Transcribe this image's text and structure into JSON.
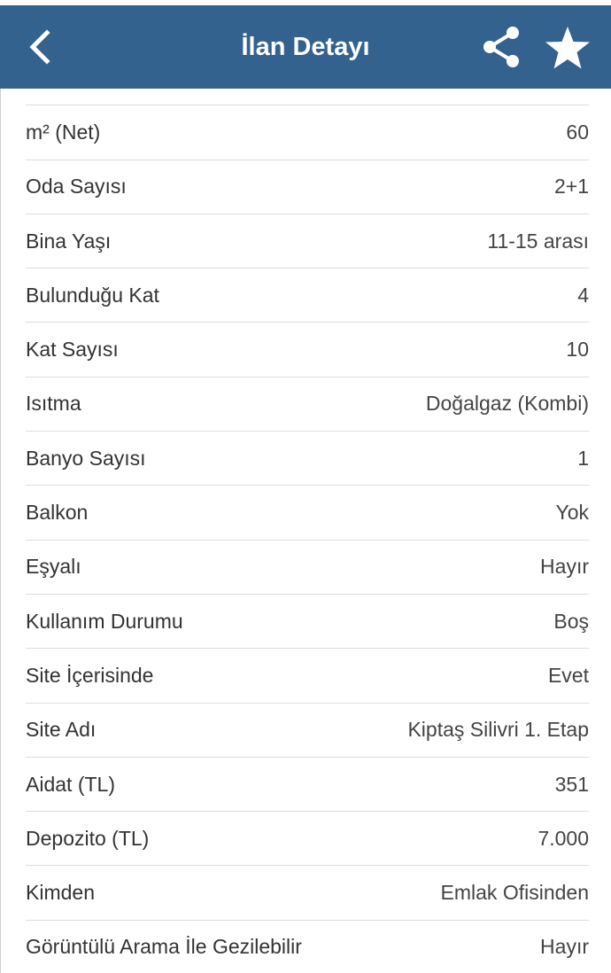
{
  "header": {
    "title": "İlan Detayı",
    "background": "#33628f",
    "icons": {
      "back": "back-arrow-icon",
      "share": "share-icon",
      "favorite": "star-icon"
    }
  },
  "details": [
    {
      "label": "",
      "value": ""
    },
    {
      "label": "m² (Net)",
      "value": "60"
    },
    {
      "label": "Oda Sayısı",
      "value": "2+1"
    },
    {
      "label": "Bina Yaşı",
      "value": "11-15 arası"
    },
    {
      "label": "Bulunduğu Kat",
      "value": "4"
    },
    {
      "label": "Kat Sayısı",
      "value": "10"
    },
    {
      "label": "Isıtma",
      "value": "Doğalgaz (Kombi)"
    },
    {
      "label": "Banyo Sayısı",
      "value": "1"
    },
    {
      "label": "Balkon",
      "value": "Yok"
    },
    {
      "label": "Eşyalı",
      "value": "Hayır"
    },
    {
      "label": "Kullanım Durumu",
      "value": "Boş"
    },
    {
      "label": "Site İçerisinde",
      "value": "Evet"
    },
    {
      "label": "Site Adı",
      "value": "Kiptaş Silivri 1. Etap"
    },
    {
      "label": "Aidat (TL)",
      "value": "351"
    },
    {
      "label": "Depozito (TL)",
      "value": "7.000"
    },
    {
      "label": "Kimden",
      "value": "Emlak Ofisinden"
    },
    {
      "label": "Görüntülü Arama İle Gezilebilir",
      "value": "Hayır"
    }
  ]
}
